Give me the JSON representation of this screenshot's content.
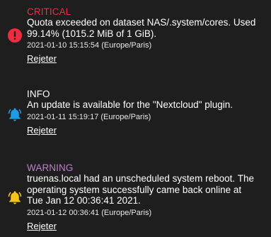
{
  "colors": {
    "critical": "#ef2b3f",
    "info": "#ffffff",
    "warning": "#c17ecc",
    "bell_info": "#1e9be4",
    "bell_warning": "#f5c518",
    "background": "#1e1e1e"
  },
  "alerts": [
    {
      "level": "CRITICAL",
      "icon": "error-circle-icon",
      "message_lines": [
        "Quota exceeded on dataset NAS/.system/cores. Used",
        "99.14% (1015.2 MiB of 1 GiB)."
      ],
      "timestamp": "2021-01-10 15:15:54 (Europe/Paris)",
      "dismiss_label": "Rejeter"
    },
    {
      "level": "INFO",
      "icon": "bell-icon",
      "message_lines": [
        "An update is available for the \"Nextcloud\" plugin."
      ],
      "timestamp": "2021-01-11 15:19:17 (Europe/Paris)",
      "dismiss_label": "Rejeter"
    },
    {
      "level": "WARNING",
      "icon": "bell-icon",
      "message_lines": [
        "truenas.local had an unscheduled system reboot. The",
        "operating system successfully came back online at",
        "Tue Jan 12 00:36:41 2021."
      ],
      "timestamp": "2021-01-12 00:36:41 (Europe/Paris)",
      "dismiss_label": "Rejeter"
    }
  ]
}
